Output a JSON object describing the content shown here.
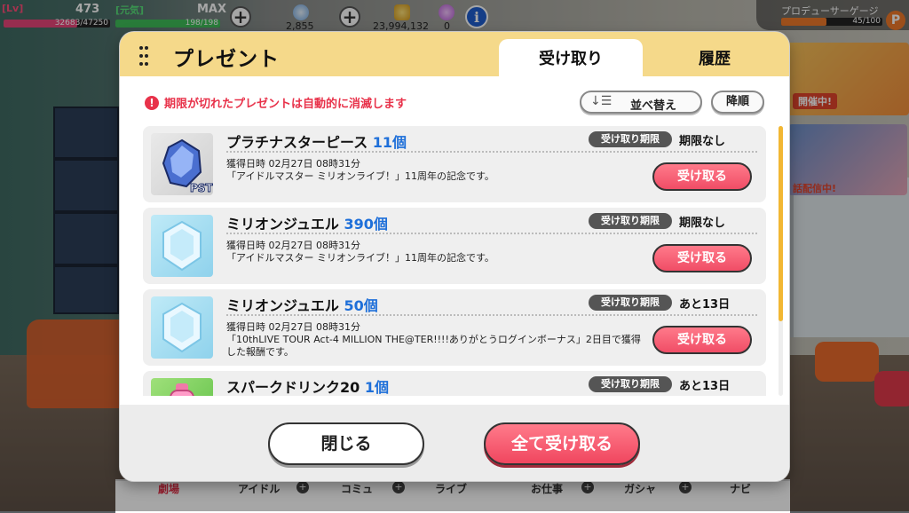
{
  "status": {
    "lv_label": "[Lv]",
    "lv_value": "473",
    "exp_text": "32683/47250",
    "exp_fraction": 0.69,
    "genki_label": "[元気]",
    "genki_max": "MAX",
    "genki_text": "198/198",
    "genki_fraction": 1.0,
    "jewel_count": "2,855",
    "money_count": "23,994,132",
    "ticket_count": "0",
    "producer_gauge_label": "プロデューサーゲージ",
    "producer_gauge_text": "45/100",
    "producer_gauge_fraction": 0.45,
    "producer_icon_letter": "P",
    "info_icon": "i"
  },
  "background": {
    "banner_badge": "開催中!",
    "poster_text": "話配信中!"
  },
  "nav": {
    "items": [
      "劇場",
      "アイドル",
      "コミュ",
      "ライブ",
      "お仕事",
      "ガシャ",
      "ナビ"
    ]
  },
  "modal": {
    "title": "プレゼント",
    "tab_receive": "受け取り",
    "tab_history": "履歴",
    "warning": "期限が切れたプレゼントは自動的に消滅します",
    "sort_label": "並べ替え",
    "order_label": "降順",
    "deadline_badge": "受け取り期限",
    "receive_button": "受け取る",
    "close_button": "閉じる",
    "receive_all_button": "全て受け取る",
    "items": [
      {
        "name": "プラチナスターピース",
        "qty": "11個",
        "deadline": "期限なし",
        "date": "獲得日時 02月27日 08時31分",
        "desc": "「アイドルマスター ミリオンライブ！」11周年の記念です。",
        "thumb_label": "PST"
      },
      {
        "name": "ミリオンジュエル",
        "qty": "390個",
        "deadline": "期限なし",
        "date": "獲得日時 02月27日 08時31分",
        "desc": "「アイドルマスター ミリオンライブ！」11周年の記念です。"
      },
      {
        "name": "ミリオンジュエル",
        "qty": "50個",
        "deadline": "あと13日",
        "date": "獲得日時 02月27日 08時31分",
        "desc": "「10thLIVE TOUR Act-4 MILLION THE@TER!!!!ありがとうログインボーナス」2日目で獲得した報酬です。"
      },
      {
        "name": "スパークドリンク20",
        "qty": "1個",
        "deadline": "あと13日",
        "date": "",
        "desc": ""
      }
    ]
  },
  "colors": {
    "accent_pink": "#f04d66",
    "header_gold": "#f5d98a",
    "qty_blue": "#1e6fd9",
    "warning_red": "#e8324a"
  }
}
